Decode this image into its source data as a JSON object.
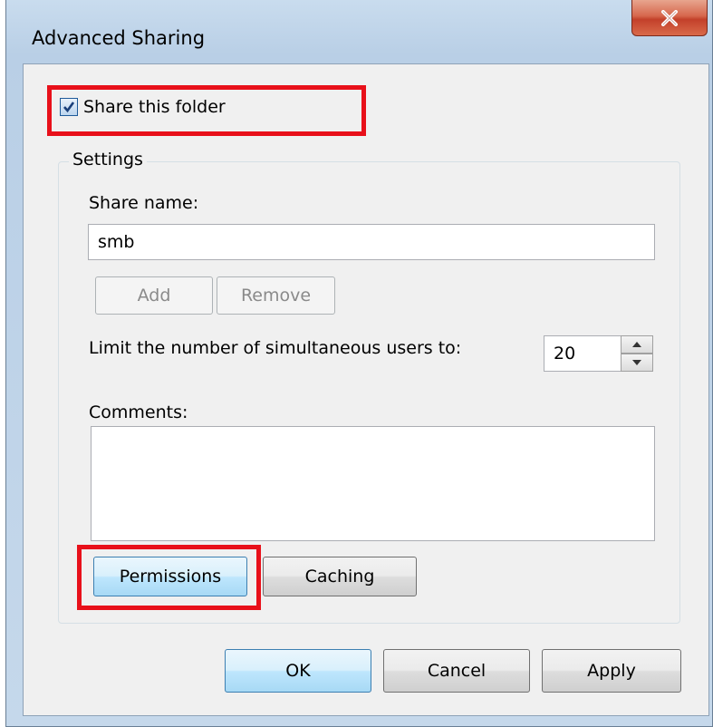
{
  "window": {
    "title": "Advanced Sharing"
  },
  "share_checkbox": {
    "label": "Share this folder",
    "checked": true
  },
  "settings": {
    "legend": "Settings",
    "share_name_label": "Share name:",
    "share_name_value": "smb",
    "add_label": "Add",
    "remove_label": "Remove",
    "limit_label": "Limit the number of simultaneous users to:",
    "limit_value": "20",
    "comments_label": "Comments:",
    "comments_value": "",
    "permissions_label": "Permissions",
    "caching_label": "Caching"
  },
  "footer": {
    "ok_label": "OK",
    "cancel_label": "Cancel",
    "apply_label": "Apply"
  },
  "colors": {
    "highlight": "#e8101a",
    "close": "#c3402a",
    "default_button": "#3c7fb1"
  },
  "icons": [
    "close-icon",
    "checkmark-icon",
    "spin-up-icon",
    "spin-down-icon"
  ]
}
